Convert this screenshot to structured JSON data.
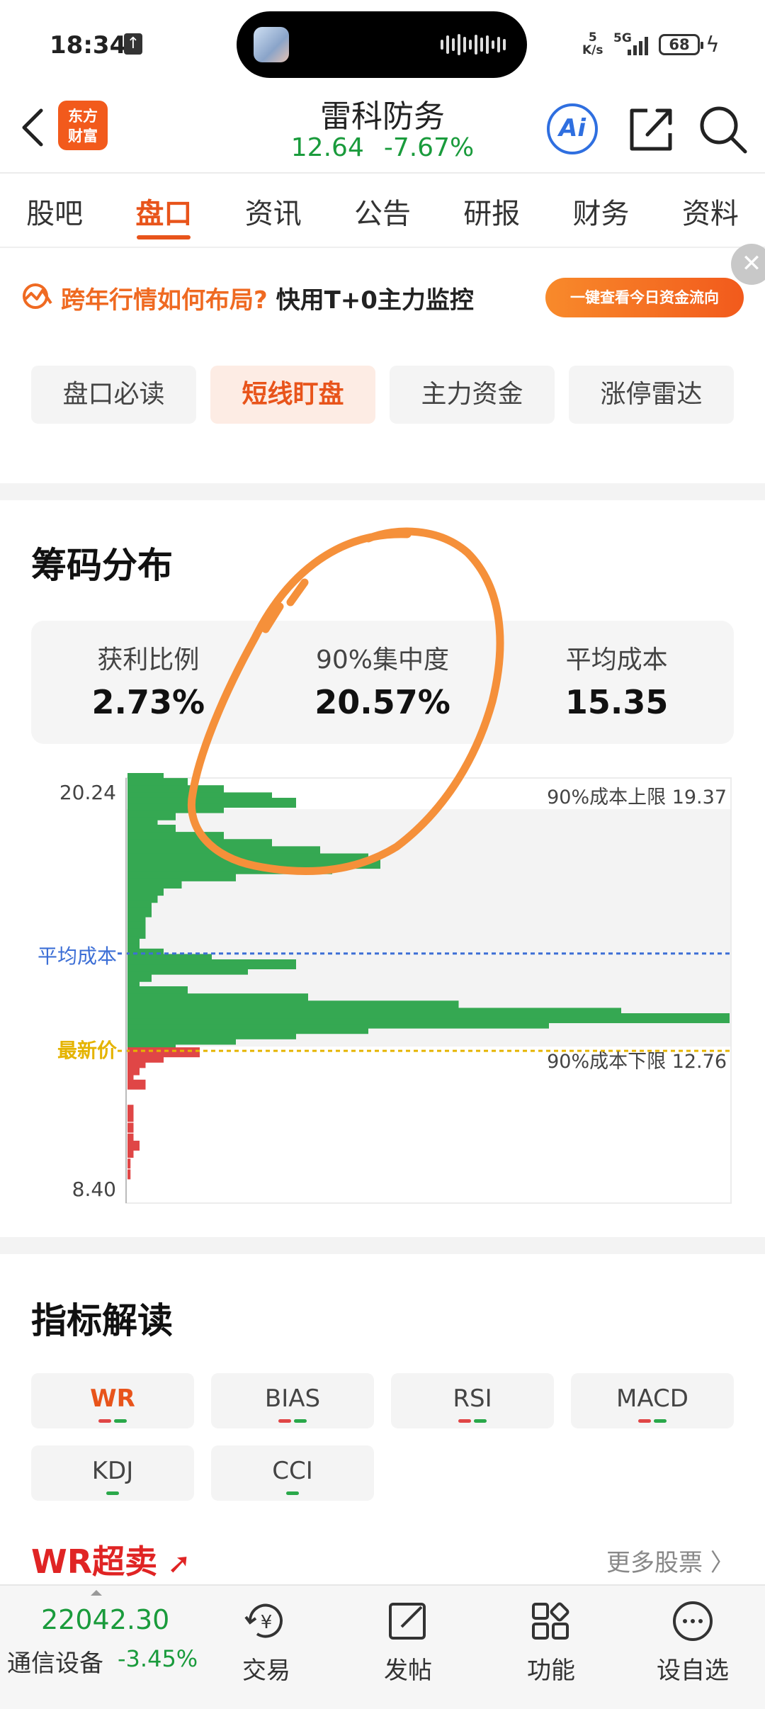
{
  "status": {
    "time": "18:34",
    "net_speed_top": "5",
    "net_speed_unit": "K/s",
    "network": "5G",
    "battery": "68"
  },
  "header": {
    "logo_line1": "东方",
    "logo_line2": "财富",
    "stock_name": "雷科防务",
    "price": "12.64",
    "change_pct": "-7.67%",
    "ai_label": "Ai"
  },
  "tabs": [
    "股吧",
    "盘口",
    "资讯",
    "公告",
    "研报",
    "财务",
    "资料"
  ],
  "banner": {
    "text_orange": "跨年行情如何布局?",
    "text_dark": "快用T+0主力监控",
    "button": "一键查看今日资金流向",
    "close": "✕"
  },
  "subtabs": [
    "盘口必读",
    "短线盯盘",
    "主力资金",
    "涨停雷达"
  ],
  "chips": {
    "title": "筹码分布",
    "stats": [
      {
        "label": "获利比例",
        "value": "2.73%"
      },
      {
        "label": "90%集中度",
        "value": "20.57%"
      },
      {
        "label": "平均成本",
        "value": "15.35"
      }
    ],
    "y_max_label": "20.24",
    "y_min_label": "8.40",
    "avg_cost_label": "平均成本",
    "latest_price_label": "最新价",
    "upper_label": "90%成本上限 19.37",
    "lower_label": "90%成本下限 12.76",
    "colors": {
      "profit": "#e04646",
      "loss": "#35a852",
      "avg_line": "#3d6fd6",
      "price_line": "#e5b400",
      "annotation": "#f5903a"
    }
  },
  "chart_data": {
    "type": "bar",
    "orientation": "horizontal",
    "title": "筹码分布",
    "ylim": [
      8.4,
      20.24
    ],
    "average_cost": 15.35,
    "latest_price": 12.64,
    "cost_90_upper": 19.37,
    "cost_90_lower": 12.76,
    "series": [
      {
        "color": "#35a852",
        "points": [
          [
            20.24,
            0.06
          ],
          [
            20.1,
            0.1
          ],
          [
            19.9,
            0.16
          ],
          [
            19.7,
            0.24
          ],
          [
            19.55,
            0.28
          ],
          [
            19.4,
            0.16
          ],
          [
            19.2,
            0.08
          ],
          [
            19.0,
            0.05
          ],
          [
            18.8,
            0.08
          ],
          [
            18.6,
            0.16
          ],
          [
            18.4,
            0.24
          ],
          [
            18.2,
            0.32
          ],
          [
            18.0,
            0.4
          ],
          [
            17.85,
            0.42
          ],
          [
            17.7,
            0.34
          ],
          [
            17.5,
            0.18
          ],
          [
            17.3,
            0.09
          ],
          [
            17.1,
            0.06
          ],
          [
            16.9,
            0.05
          ],
          [
            16.7,
            0.04
          ],
          [
            16.5,
            0.04
          ],
          [
            16.3,
            0.03
          ],
          [
            16.1,
            0.03
          ],
          [
            15.9,
            0.03
          ],
          [
            15.7,
            0.02
          ],
          [
            15.5,
            0.02
          ],
          [
            15.35,
            0.06
          ],
          [
            15.2,
            0.14
          ],
          [
            15.05,
            0.28
          ],
          [
            14.9,
            0.2
          ],
          [
            14.7,
            0.04
          ],
          [
            14.5,
            0.02
          ],
          [
            14.3,
            0.1
          ],
          [
            14.1,
            0.3
          ],
          [
            13.9,
            0.55
          ],
          [
            13.7,
            0.82
          ],
          [
            13.55,
            1.0
          ],
          [
            13.4,
            0.7
          ],
          [
            13.25,
            0.4
          ],
          [
            13.1,
            0.28
          ],
          [
            12.95,
            0.18
          ],
          [
            12.8,
            0.08
          ]
        ]
      },
      {
        "color": "#e04646",
        "points": [
          [
            12.6,
            0.12
          ],
          [
            12.45,
            0.06
          ],
          [
            12.3,
            0.03
          ],
          [
            12.1,
            0.02
          ],
          [
            11.9,
            0.01
          ],
          [
            11.7,
            0.03
          ],
          [
            11.0,
            0.01
          ],
          [
            10.8,
            0.01
          ],
          [
            10.5,
            0.01
          ],
          [
            10.2,
            0.01
          ],
          [
            10.0,
            0.02
          ],
          [
            9.8,
            0.01
          ],
          [
            9.5,
            0.005
          ],
          [
            9.2,
            0.005
          ]
        ]
      }
    ]
  },
  "indicators": {
    "title": "指标解读",
    "chips": [
      {
        "label": "WR",
        "dots": [
          "#e04646",
          "#2aa84a"
        ]
      },
      {
        "label": "BIAS",
        "dots": [
          "#e04646",
          "#2aa84a"
        ]
      },
      {
        "label": "RSI",
        "dots": [
          "#e04646",
          "#2aa84a"
        ]
      },
      {
        "label": "MACD",
        "dots": [
          "#e04646",
          "#2aa84a"
        ]
      },
      {
        "label": "KDJ",
        "dots": [
          "#2aa84a"
        ]
      },
      {
        "label": "CCI",
        "dots": [
          "#2aa84a"
        ]
      }
    ],
    "wr_title": "WR超卖",
    "more": "更多股票 〉"
  },
  "bottom": {
    "index_value": "22042.30",
    "index_name": "通信设备",
    "index_change": "-3.45%",
    "items": [
      {
        "label": "交易",
        "icon": "trade-icon"
      },
      {
        "label": "发帖",
        "icon": "post-icon"
      },
      {
        "label": "功能",
        "icon": "function-icon"
      },
      {
        "label": "设自选",
        "icon": "add-watchlist-icon"
      }
    ]
  }
}
